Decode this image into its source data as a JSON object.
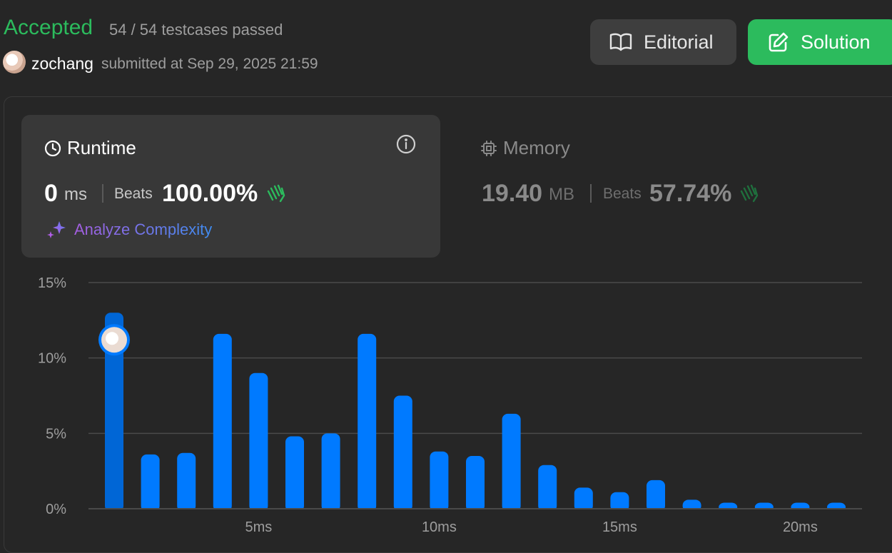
{
  "result": {
    "status": "Accepted",
    "testcases": "54 / 54 testcases passed",
    "username": "zochang",
    "submitted": "submitted at Sep 29, 2025 21:59"
  },
  "buttons": {
    "editorial": "Editorial",
    "solution": "Solution"
  },
  "runtime": {
    "title": "Runtime",
    "value": "0",
    "unit": "ms",
    "beats_label": "Beats",
    "beats_value": "100.00%",
    "analyze": "Analyze Complexity"
  },
  "memory": {
    "title": "Memory",
    "value": "19.40",
    "unit": "MB",
    "beats_label": "Beats",
    "beats_value": "57.74%"
  },
  "colors": {
    "accepted": "#2cbb5d",
    "bar": "#007aff",
    "bar_selected": "#0066d6",
    "grid": "#4a4a4a"
  },
  "chart_data": {
    "type": "bar",
    "ylim": [
      0,
      15
    ],
    "y_ticks": [
      "0%",
      "5%",
      "10%",
      "15%"
    ],
    "y_tick_values": [
      0,
      5,
      10,
      15
    ],
    "x_tick_labels": [
      "5ms",
      "10ms",
      "15ms",
      "20ms"
    ],
    "x_tick_values": [
      5,
      10,
      15,
      20
    ],
    "x": [
      1,
      2,
      3,
      4,
      5,
      6,
      7,
      8,
      9,
      10,
      11,
      12,
      13,
      14,
      15,
      16,
      17,
      18,
      19,
      20,
      21
    ],
    "values": [
      13.0,
      3.6,
      3.7,
      11.6,
      9.0,
      4.8,
      5.0,
      11.6,
      7.5,
      3.8,
      3.5,
      6.3,
      2.9,
      1.4,
      1.1,
      1.9,
      0.6,
      0.4,
      0.4,
      0.4,
      0.4
    ],
    "selected_index": 0,
    "grid": true
  }
}
